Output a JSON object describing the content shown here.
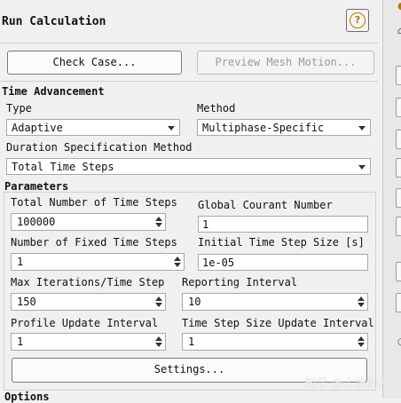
{
  "panel": {
    "title": "Run Calculation",
    "help_symbol": "?"
  },
  "buttons": {
    "check_case": "Check Case...",
    "preview_mesh": "Preview Mesh Motion...",
    "settings": "Settings..."
  },
  "time_advancement": {
    "label": "Time Advancement",
    "type_label": "Type",
    "type_value": "Adaptive",
    "method_label": "Method",
    "method_value": "Multiphase-Specific",
    "duration_label": "Duration Specification Method",
    "duration_value": "Total Time Steps"
  },
  "parameters": {
    "label": "Parameters",
    "total_steps_label": "Total Number of Time Steps",
    "total_steps_value": "100000",
    "courant_label": "Global Courant Number",
    "courant_value": "1",
    "fixed_steps_label": "Number of Fixed Time Steps",
    "fixed_steps_value": "1",
    "initial_step_label": "Initial Time Step Size [s]",
    "initial_step_value": "1e-05",
    "max_iter_label": "Max Iterations/Time Step",
    "max_iter_value": "150",
    "reporting_label": "Reporting Interval",
    "reporting_value": "10",
    "profile_label": "Profile Update Interval",
    "profile_value": "1",
    "step_update_label": "Time Step Size Update Interval",
    "step_update_value": "1"
  },
  "options": {
    "label": "Options"
  },
  "watermark": "知乎 @上波的人",
  "colors": {
    "help_accent": "#b37a00",
    "background": "#f0f0f0"
  }
}
